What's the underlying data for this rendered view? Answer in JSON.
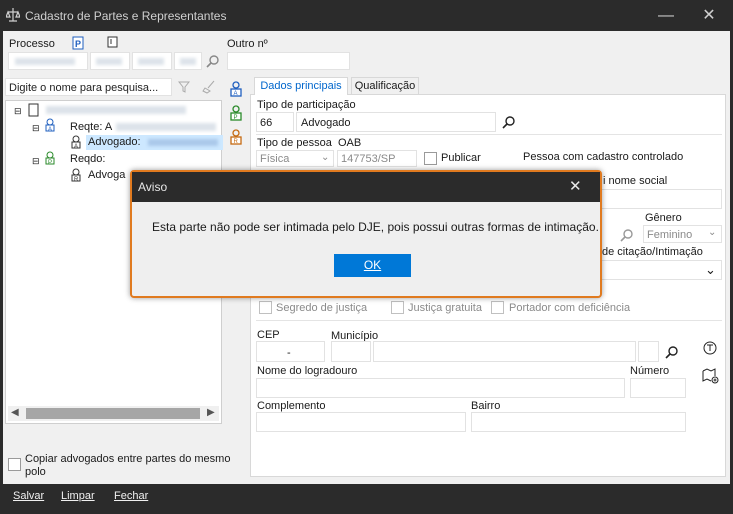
{
  "window": {
    "title": "Cadastro de Partes e Representantes",
    "minimize_glyph": "—",
    "close_glyph": "✕",
    "app_icon": "scales-icon"
  },
  "left": {
    "processo_label": "Processo",
    "outro_label": "Outro nº",
    "search_placeholder": "Digite o nome para pesquisa...",
    "tree": {
      "reqte_label": "Reqte: A",
      "advogado1_label": "Advogado:",
      "reqdo_label": "Reqdo:",
      "advogado2_label": "Advoga"
    },
    "copy_checkbox_label": "Copiar advogados entre partes do mesmo polo",
    "copy_checked": false
  },
  "tabs": [
    {
      "label": "Dados principais",
      "active": true
    },
    {
      "label": "Qualificação",
      "active": false
    }
  ],
  "form": {
    "tipo_participacao_label": "Tipo de participação",
    "tipo_participacao_code": "66",
    "tipo_participacao_value": "Advogado",
    "tipo_pessoa_label": "Tipo de pessoa",
    "tipo_pessoa_value": "Física",
    "oab_label": "OAB",
    "oab_value": "147753/SP",
    "publicar_label": "Publicar",
    "cadastro_controlado": "Pessoa com cadastro controlado",
    "nome_social_label": "i nome social",
    "genero_label": "Gênero",
    "genero_value": "Feminino",
    "citacao_label": "de citação/Intimação",
    "segredo_label": "Segredo de justiça",
    "justica_label": "Justiça gratuita",
    "portador_label": "Portador com deficiência",
    "cep_label": "CEP",
    "cep_value": "-",
    "municipio_label": "Município",
    "logradouro_label": "Nome do logradouro",
    "numero_label": "Número",
    "complemento_label": "Complemento",
    "bairro_label": "Bairro"
  },
  "bottom": {
    "salvar": "Salvar",
    "limpar": "Limpar",
    "fechar": "Fechar"
  },
  "dialog": {
    "title": "Aviso",
    "close_glyph": "✕",
    "message": "Esta parte não pode ser intimada pelo DJE, pois possui outras formas de intimação.",
    "ok_label": "OK"
  },
  "colors": {
    "accent": "#0078d7",
    "dialog_border": "#e07a1f",
    "dark_bar": "#2b2b2b",
    "tab_active": "#0066cc"
  }
}
